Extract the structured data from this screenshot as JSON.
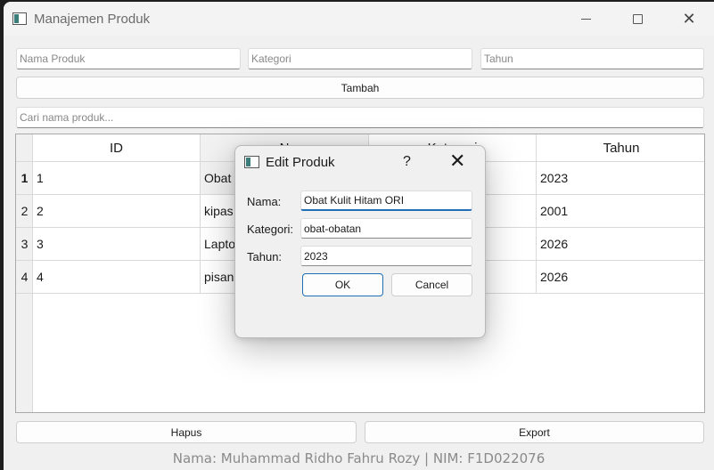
{
  "window": {
    "title": "Manajemen Produk",
    "icon": "app-window-icon"
  },
  "form": {
    "nama_placeholder": "Nama Produk",
    "kategori_placeholder": "Kategori",
    "tahun_placeholder": "Tahun",
    "tambah_label": "Tambah",
    "search_placeholder": "Cari nama produk..."
  },
  "table": {
    "headers": [
      "ID",
      "N",
      "Kategori",
      "Tahun"
    ],
    "rows": [
      {
        "num": "1",
        "id": "1",
        "nama": "Obat",
        "tahun": "2023"
      },
      {
        "num": "2",
        "id": "2",
        "nama": "kipas",
        "tahun": "2001"
      },
      {
        "num": "3",
        "id": "3",
        "nama": "Lapto",
        "tahun": "2026"
      },
      {
        "num": "4",
        "id": "4",
        "nama": "pisan",
        "tahun": "2026"
      }
    ]
  },
  "actions": {
    "hapus_label": "Hapus",
    "export_label": "Export"
  },
  "footer": {
    "text": "Nama: Muhammad Ridho Fahru Rozy | NIM: F1D022076"
  },
  "dialog": {
    "title": "Edit Produk",
    "help": "?",
    "nama_label": "Nama:",
    "nama_value": "Obat Kulit Hitam ORI",
    "kategori_label": "Kategori:",
    "kategori_value": "obat-obatan",
    "tahun_label": "Tahun:",
    "tahun_value": "2023",
    "ok_label": "OK",
    "cancel_label": "Cancel"
  },
  "colors": {
    "accent": "#1f6fb2",
    "window_bg": "#f0f0f0"
  }
}
